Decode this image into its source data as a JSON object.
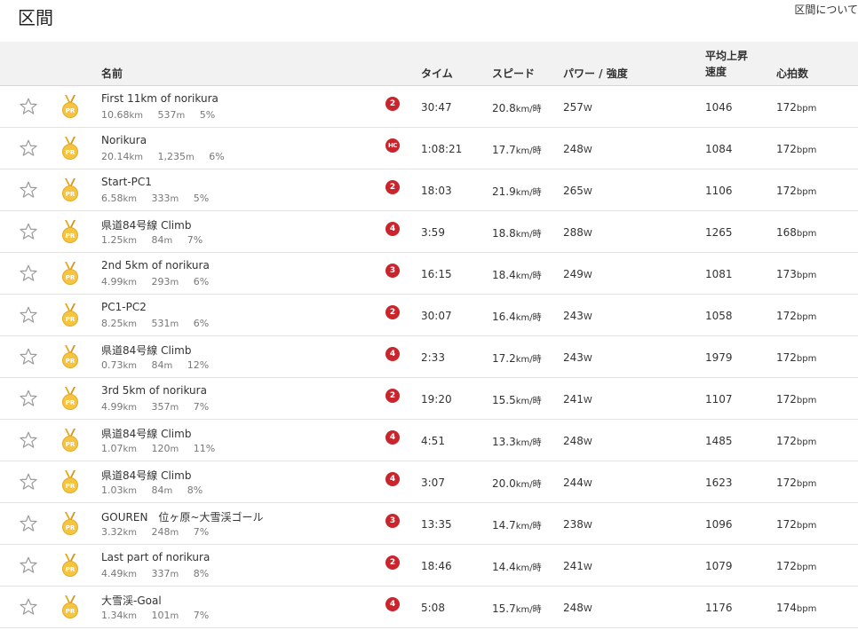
{
  "page": {
    "title": "区間",
    "about_link": "区間について"
  },
  "columns": {
    "name": "名前",
    "time": "タイム",
    "speed": "スピード",
    "power": "パワー / 強度",
    "vam_line1": "平均上昇",
    "vam_line2": "速度",
    "hr": "心拍数"
  },
  "medal_label": "PR",
  "units": {
    "dist": "km",
    "elev": "m",
    "speed": "km/時",
    "power": "W",
    "hr": "bpm"
  },
  "segments": [
    {
      "name": "First 11km of norikura",
      "dist": "10.68",
      "elev": "537",
      "grade": "5%",
      "cat": "2",
      "time": "30:47",
      "speed": "20.8",
      "power": "257",
      "vam": "1046",
      "hr": "172"
    },
    {
      "name": "Norikura",
      "dist": "20.14",
      "elev": "1,235",
      "grade": "6%",
      "cat": "HC",
      "time": "1:08:21",
      "speed": "17.7",
      "power": "248",
      "vam": "1084",
      "hr": "172"
    },
    {
      "name": "Start-PC1",
      "dist": "6.58",
      "elev": "333",
      "grade": "5%",
      "cat": "2",
      "time": "18:03",
      "speed": "21.9",
      "power": "265",
      "vam": "1106",
      "hr": "172"
    },
    {
      "name": "県道84号線 Climb",
      "dist": "1.25",
      "elev": "84",
      "grade": "7%",
      "cat": "4",
      "time": "3:59",
      "speed": "18.8",
      "power": "288",
      "vam": "1265",
      "hr": "168"
    },
    {
      "name": "2nd 5km of norikura",
      "dist": "4.99",
      "elev": "293",
      "grade": "6%",
      "cat": "3",
      "time": "16:15",
      "speed": "18.4",
      "power": "249",
      "vam": "1081",
      "hr": "173"
    },
    {
      "name": "PC1-PC2",
      "dist": "8.25",
      "elev": "531",
      "grade": "6%",
      "cat": "2",
      "time": "30:07",
      "speed": "16.4",
      "power": "243",
      "vam": "1058",
      "hr": "172"
    },
    {
      "name": "県道84号線 Climb",
      "dist": "0.73",
      "elev": "84",
      "grade": "12%",
      "cat": "4",
      "time": "2:33",
      "speed": "17.2",
      "power": "243",
      "vam": "1979",
      "hr": "172"
    },
    {
      "name": "3rd 5km of norikura",
      "dist": "4.99",
      "elev": "357",
      "grade": "7%",
      "cat": "2",
      "time": "19:20",
      "speed": "15.5",
      "power": "241",
      "vam": "1107",
      "hr": "172"
    },
    {
      "name": "県道84号線 Climb",
      "dist": "1.07",
      "elev": "120",
      "grade": "11%",
      "cat": "4",
      "time": "4:51",
      "speed": "13.3",
      "power": "248",
      "vam": "1485",
      "hr": "172"
    },
    {
      "name": "県道84号線 Climb",
      "dist": "1.03",
      "elev": "84",
      "grade": "8%",
      "cat": "4",
      "time": "3:07",
      "speed": "20.0",
      "power": "244",
      "vam": "1623",
      "hr": "172"
    },
    {
      "name": "GOUREN　位ヶ原~大雪渓ゴール",
      "dist": "3.32",
      "elev": "248",
      "grade": "7%",
      "cat": "3",
      "time": "13:35",
      "speed": "14.7",
      "power": "238",
      "vam": "1096",
      "hr": "172"
    },
    {
      "name": "Last part of norikura",
      "dist": "4.49",
      "elev": "337",
      "grade": "8%",
      "cat": "2",
      "time": "18:46",
      "speed": "14.4",
      "power": "241",
      "vam": "1079",
      "hr": "172"
    },
    {
      "name": "大雪渓-Goal",
      "dist": "1.34",
      "elev": "101",
      "grade": "7%",
      "cat": "4",
      "time": "5:08",
      "speed": "15.7",
      "power": "248",
      "vam": "1176",
      "hr": "174"
    }
  ],
  "colors": {
    "category_badge": "#c9252c",
    "medal_gold": "#f5c542",
    "header_bg": "#f2f2f2"
  }
}
